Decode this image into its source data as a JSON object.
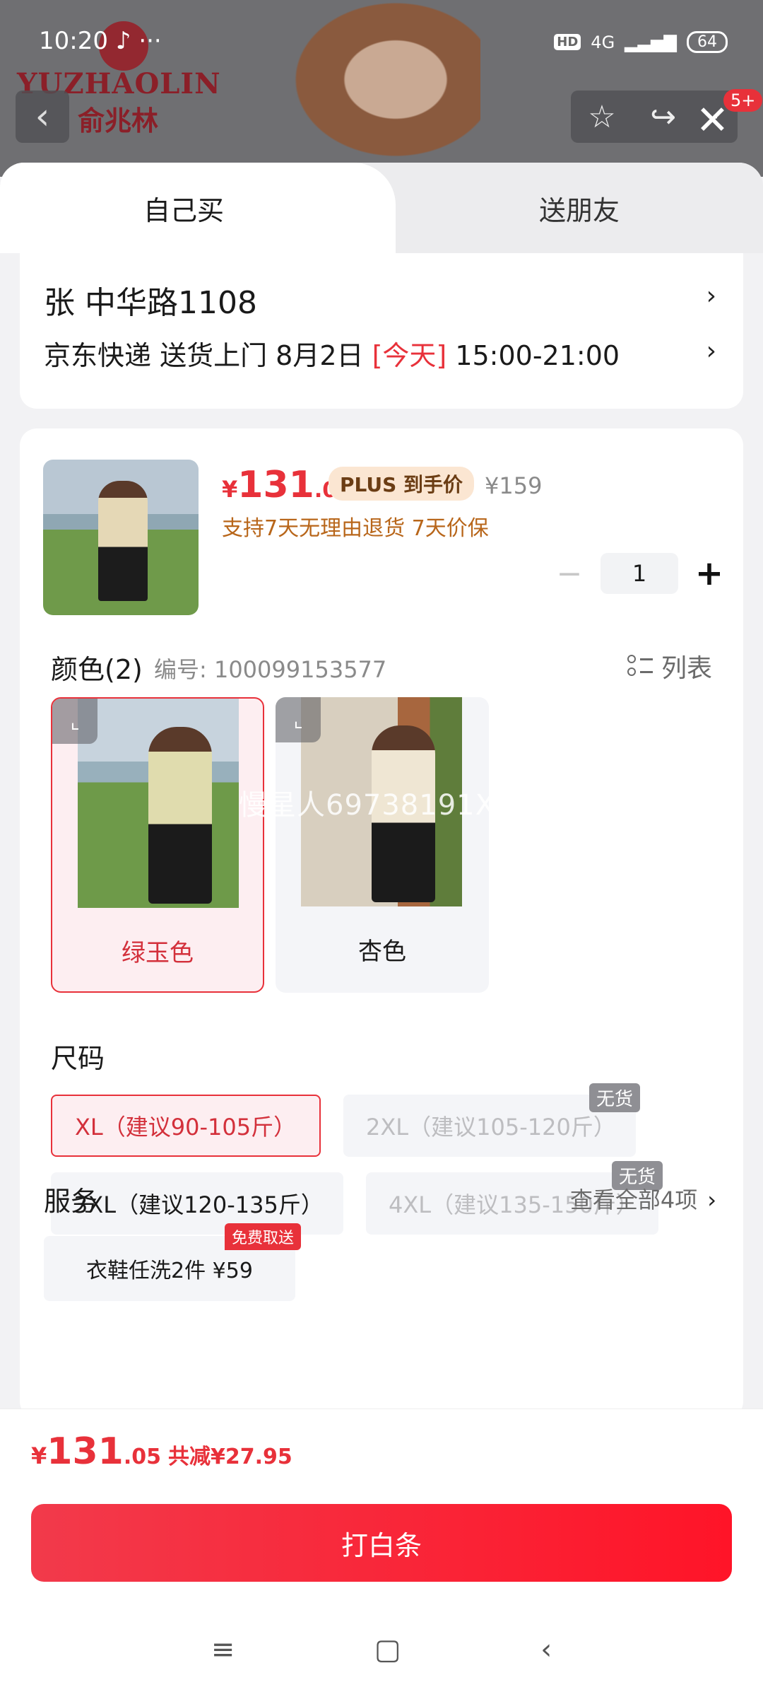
{
  "status": {
    "time": "10:20",
    "network": "4G",
    "hd": "HD",
    "battery": "64",
    "more": "···"
  },
  "brand": {
    "en": "YUZHAOLIN",
    "cn": "俞兆林"
  },
  "top_actions": {
    "badge": "5+"
  },
  "tabs": [
    {
      "label": "自己买",
      "active": true
    },
    {
      "label": "送朋友",
      "active": false
    }
  ],
  "address": {
    "line1": "张   中华路1108",
    "delivery_prefix": "京东快递 送货上门 8月2日 ",
    "delivery_today": "[今天]",
    "delivery_time": " 15:00-21:00"
  },
  "product": {
    "price_currency": "¥",
    "price_int": "131",
    "price_dec": ".05",
    "plus_tag": "PLUS 到手价",
    "original_price": "¥159",
    "support": "支持7天无理由退货  7天价保",
    "quantity": "1"
  },
  "color": {
    "title": "颜色(2)",
    "code": "编号: 100099153577",
    "list_label": "列表",
    "options": [
      {
        "label": "绿玉色",
        "selected": true
      },
      {
        "label": "杏色",
        "selected": false
      }
    ],
    "watermark": "慢星人69738191X"
  },
  "size": {
    "title": "尺码",
    "options": [
      {
        "label": "XL（建议90-105斤）",
        "selected": true,
        "available": true
      },
      {
        "label": "2XL（建议105-120斤）",
        "selected": false,
        "available": false
      },
      {
        "label": "3XL（建议120-135斤）",
        "selected": false,
        "available": true
      },
      {
        "label": "4XL（建议135-150斤）",
        "selected": false,
        "available": false
      }
    ],
    "no_stock": "无货"
  },
  "service": {
    "title": "服务",
    "view_all": "查看全部4项",
    "item": "衣鞋任洗2件  ¥59",
    "tag": "免费取送"
  },
  "bottom": {
    "total_currency": "¥",
    "total_int": "131",
    "total_dec": ".05",
    "saving": "共减¥27.95",
    "pay_label": "打白条"
  },
  "colors": {
    "accent": "#e8313a",
    "plus_bg": "#fbe6d2",
    "support_text": "#b8661a"
  }
}
